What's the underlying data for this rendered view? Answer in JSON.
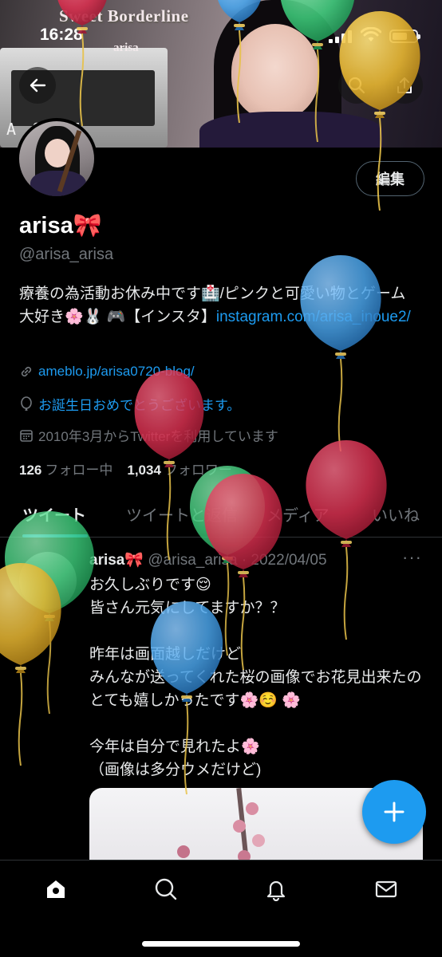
{
  "status_bar": {
    "time": "16:28"
  },
  "banner": {
    "title": "Sweet Borderline",
    "subtitle": "arisa",
    "amp_logo": "A ON E"
  },
  "profile": {
    "name": "arisa🎀",
    "handle": "@arisa_arisa",
    "edit_label": "編集",
    "bio_text": "療養の為活動お休み中です🏥/ピンクと可愛い物とゲーム大好き🌸🐰 🎮【インスタ】",
    "bio_link": "instagram.com/arisa_inoue2/",
    "website": "ameblo.jp/arisa0720-blog/",
    "birthday": "お誕生日おめでとうございます。",
    "joined": "2010年3月からTwitterを利用しています",
    "following_count": "126",
    "following_label": "フォロー中",
    "followers_count": "1,034",
    "followers_label": "フォロワー"
  },
  "tabs": [
    {
      "label": "ツイート"
    },
    {
      "label": "ツイートと返信"
    },
    {
      "label": "メディア"
    },
    {
      "label": "いいね"
    }
  ],
  "tweet": {
    "name": "arisa🎀",
    "handle": "@arisa_arisa",
    "date": "2022/04/05",
    "more": "···",
    "text": "お久しぶりです😌\n皆さん元気にしてますか？？\n\n昨年は画面越しだけど\nみんなが送ってくれた桜の画像でお花見出来たのとても嬉しかったです🌸☺️ 🌸\n\n今年は自分で見れたよ🌸\n（画像は多分ウメだけど)"
  },
  "colors": {
    "accent": "#1d9bf0",
    "background": "#000000",
    "muted": "#71767b"
  },
  "balloon_colors": [
    "#d6304f",
    "#e8b732",
    "#4aa3e8",
    "#3fd17e"
  ],
  "icons": [
    "back-arrow-icon",
    "search-icon",
    "share-icon",
    "link-icon",
    "balloon-icon",
    "calendar-icon",
    "compose-plus-icon",
    "home-icon",
    "search-nav-icon",
    "bell-icon",
    "mail-icon"
  ]
}
